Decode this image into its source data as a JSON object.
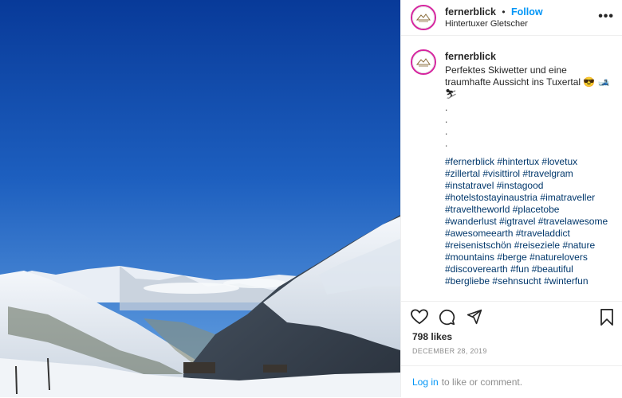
{
  "post": {
    "username": "fernerblick",
    "dot": "•",
    "follow_label": "Follow",
    "location": "Hintertuxer Gletscher",
    "more_label": "•••"
  },
  "caption": {
    "username": "fernerblick",
    "message": "Perfektes Skiwetter und eine traumhafte Aussicht ins Tuxertal 😎 🎿⛷",
    "dots": [
      ".",
      ".",
      ".",
      "."
    ],
    "hashtags": [
      "#fernerblick",
      "#hintertux",
      "#lovetux",
      "#zillertal",
      "#visittirol",
      "#travelgram",
      "#instatravel",
      "#instagood",
      "#hotelstostayinaustria",
      "#imatraveller",
      "#traveltheworld",
      "#placetobe",
      "#wanderlust",
      "#igtravel",
      "#travelawesome",
      "#awesomeearth",
      "#traveladdict",
      "#reisenistschön",
      "#reiseziele",
      "#nature",
      "#mountains",
      "#berge",
      "#naturelovers",
      "#discoverearth",
      "#fun",
      "#beautiful",
      "#bergliebe",
      "#sehnsucht",
      "#winterfun"
    ]
  },
  "stats": {
    "likes": "798 likes",
    "date": "DECEMBER 28, 2019"
  },
  "comment": {
    "login_label": "Log in",
    "prompt": "to like or comment."
  },
  "icons": {
    "like": "heart-icon",
    "comment": "comment-icon",
    "share": "share-icon",
    "save": "bookmark-icon"
  },
  "colors": {
    "link": "#0095f6",
    "hashtag": "#00376b",
    "sky_top": "#0a3f9e",
    "sky_bottom": "#5d9ee0"
  }
}
